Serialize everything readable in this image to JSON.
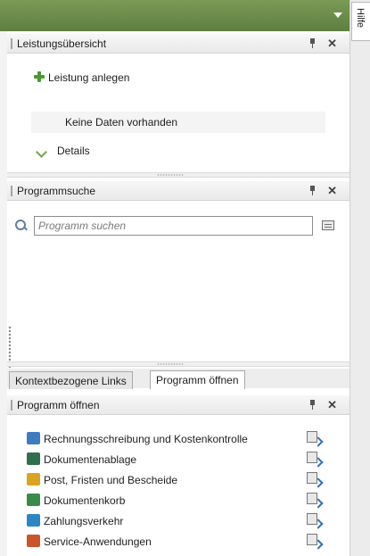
{
  "side_tab": {
    "label": "Hilfe"
  },
  "panel_leistung": {
    "title": "Leistungsübersicht",
    "add_label": "Leistung anlegen",
    "empty_text": "Keine Daten vorhanden",
    "details_label": "Details"
  },
  "panel_programmsuche": {
    "title": "Programmsuche",
    "search_placeholder": "Programm suchen"
  },
  "tabs": [
    {
      "label": "Kontextbezogene Links",
      "active": false
    },
    {
      "label": "Programm öffnen",
      "active": true
    }
  ],
  "panel_programm": {
    "title": "Programm öffnen",
    "items": [
      {
        "label": "Rechnungsschreibung und Kostenkontrolle",
        "icon": "invoice-icon",
        "color": "#3f7bbf"
      },
      {
        "label": "Dokumentenablage",
        "icon": "document-storage-icon",
        "color": "#2f6f4f"
      },
      {
        "label": "Post, Fristen und Bescheide",
        "icon": "mail-deadline-icon",
        "color": "#d9a521"
      },
      {
        "label": "Dokumentenkorb",
        "icon": "document-basket-icon",
        "color": "#3a8a4a"
      },
      {
        "label": "Zahlungsverkehr",
        "icon": "payment-icon",
        "color": "#2c86c4"
      },
      {
        "label": "Service-Anwendungen",
        "icon": "service-icon",
        "color": "#c9552b"
      }
    ]
  }
}
